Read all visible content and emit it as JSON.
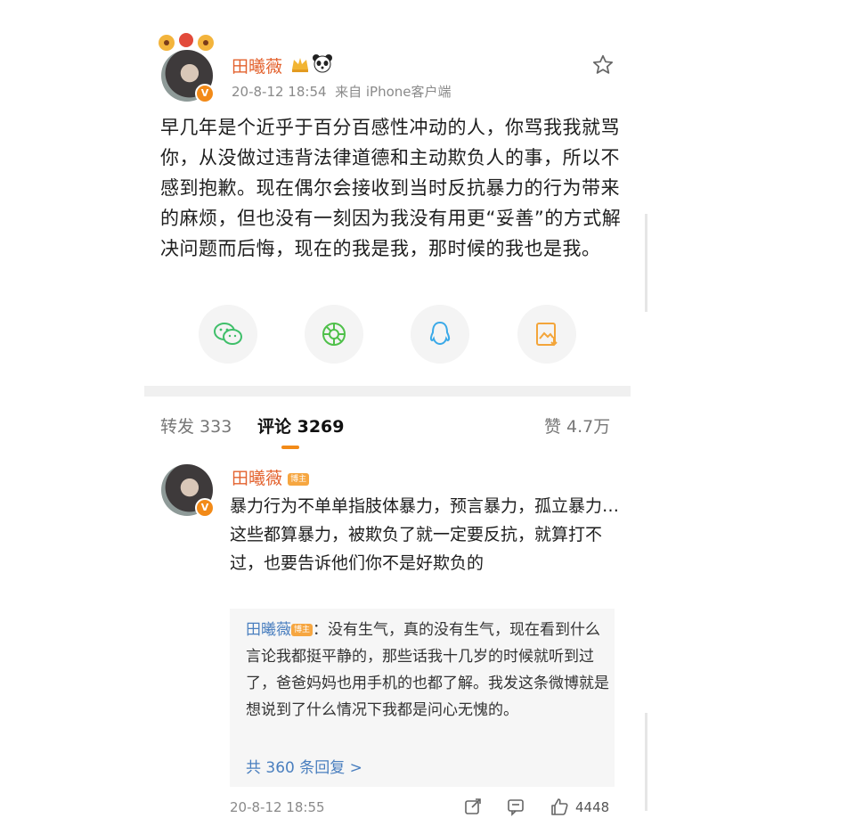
{
  "post": {
    "username": "田曦薇",
    "timestamp": "20-8-12 18:54",
    "source": "来自 iPhone客户端",
    "text": "早几年是个近乎于百分百感性冲动的人，你骂我我就骂你，从没做过违背法律道德和主动欺负人的事，所以不感到抱歉。现在偶尔会接收到当时反抗暴力的行为带来的麻烦，但也没有一刻因为我没有用更“妥善”的方式解决问题而后悔，现在的我是我，那时候的我也是我。",
    "share_icons": [
      "wechat-icon",
      "moments-icon",
      "qq-icon",
      "save-image-icon"
    ]
  },
  "tabs": {
    "repost": "转发 333",
    "comments": "评论 3269",
    "likes": "赞 4.7万"
  },
  "comment": {
    "username": "田曦薇",
    "badge": "博主",
    "text": "暴力行为不单单指肢体暴力，预言暴力，孤立暴力…这些都算暴力，被欺负了就一定要反抗，就算打不过，也要告诉他们你不是好欺负的",
    "reply": {
      "name": "田曦薇",
      "badge": "博主",
      "text": "：没有生气，真的没有生气，现在看到什么言论我都挺平静的，那些话我十几岁的时候就听到过了，爸爸妈妈也用手机的也都了解。我发这条微博就是想说到了什么情况下我都是问心无愧的。",
      "count_link": "共 360 条回复 >"
    },
    "timestamp": "20-8-12 18:55",
    "likes": "4448"
  },
  "colors": {
    "accent": "#f28a18",
    "username": "#e3622e",
    "link": "#4a7fbf"
  }
}
